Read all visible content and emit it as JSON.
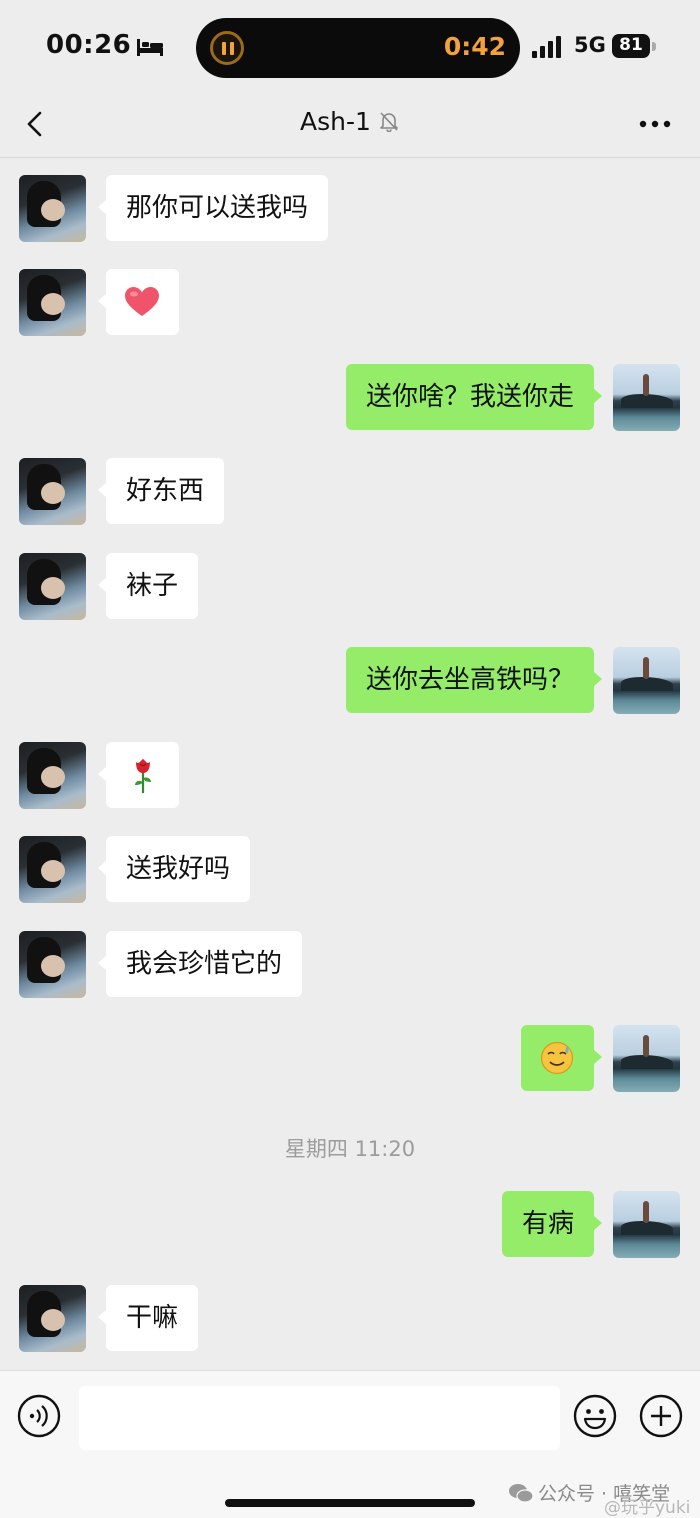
{
  "status_bar": {
    "time": "00:26",
    "timer": "0:42",
    "network": "5G",
    "battery": "81",
    "icons": [
      "bed-icon",
      "pause-icon",
      "signal-icon",
      "battery-icon"
    ]
  },
  "header": {
    "title": "Ash-1",
    "icons": [
      "back-icon",
      "mute-bell-icon",
      "more-icon"
    ]
  },
  "messages": [
    {
      "side": "left",
      "text": "那你可以送我吗"
    },
    {
      "side": "left",
      "emoji": "heart"
    },
    {
      "side": "right",
      "text": "送你啥？我送你走"
    },
    {
      "side": "left",
      "text": "好东西"
    },
    {
      "side": "left",
      "text": "袜子"
    },
    {
      "side": "right",
      "text": "送你去坐高铁吗？"
    },
    {
      "side": "left",
      "emoji": "rose"
    },
    {
      "side": "left",
      "text": "送我好吗"
    },
    {
      "side": "left",
      "text": "我会珍惜它的"
    },
    {
      "side": "right",
      "emoji": "sweat-smile-face"
    },
    {
      "side": "right",
      "text": "有病"
    },
    {
      "side": "left",
      "text": "干嘛"
    }
  ],
  "timestamp": "星期四 11:20",
  "input_bar": {
    "icons": [
      "voice-icon",
      "emoji-icon",
      "plus-icon"
    ],
    "value": ""
  },
  "watermark": {
    "text": "公众号 · 嘻笑堂",
    "secondary": "@玩乎yuki"
  },
  "colors": {
    "background": "#ededed",
    "sent_bubble": "#95ec69",
    "received_bubble": "#ffffff",
    "timer": "#f2a13c"
  }
}
